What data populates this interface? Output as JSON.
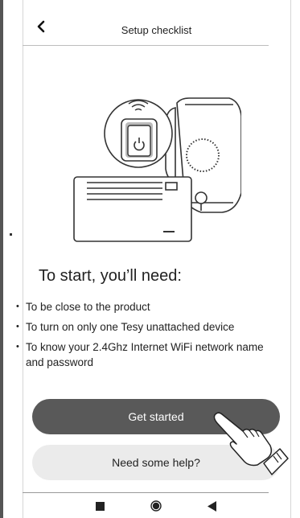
{
  "header": {
    "title": "Setup checklist",
    "back_icon": "chevron-left-icon"
  },
  "intro": {
    "heading": "To start, you’ll need:",
    "requirements": [
      "To be close to the product",
      "To turn on only one Tesy unattached device",
      "To know your 2.4Ghz Internet WiFi network name",
      "and password"
    ]
  },
  "actions": {
    "primary_label": "Get started",
    "secondary_label": "Need some help?",
    "primary_color": "#595959",
    "secondary_color": "#ebebeb"
  },
  "nav_bar": {
    "recent_icon": "square-icon",
    "home_icon": "circle-icon",
    "back_icon": "triangle-back-icon"
  }
}
